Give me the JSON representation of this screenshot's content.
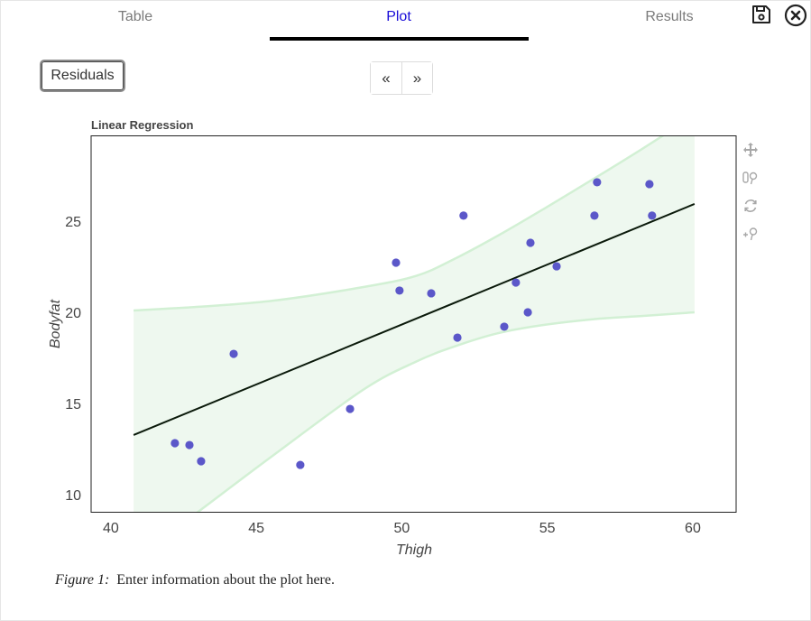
{
  "tabs": [
    {
      "label": "Table",
      "active": false
    },
    {
      "label": "Plot",
      "active": true
    },
    {
      "label": "Results",
      "active": false
    }
  ],
  "header_icons": [
    "save-icon",
    "close-circle-icon"
  ],
  "residuals_button": "Residuals",
  "pager": {
    "prev": "«",
    "next": "»"
  },
  "toolbar": [
    "move-icon",
    "zoom-box-icon",
    "reset-icon",
    "zoom-in-icon"
  ],
  "caption": {
    "figure": "Figure 1:",
    "text": "Enter information about the plot here."
  },
  "colors": {
    "accent_tab": "#1a0dd8",
    "points": "#5b57c9",
    "band_fill": "#eef8ef",
    "band_line": "#d2f0d4",
    "fit_line": "#0b1a0b"
  },
  "chart_data": {
    "type": "scatter",
    "title": "Linear Regression",
    "xlabel": "Thigh",
    "ylabel": "Bodyfat",
    "xlim": [
      39.32,
      61.49
    ],
    "ylim": [
      9.06,
      29.7
    ],
    "xticks": [
      40,
      45,
      50,
      55,
      60
    ],
    "yticks": [
      10,
      15,
      20,
      25
    ],
    "grid": false,
    "points": [
      {
        "x": 42.2,
        "y": 12.82
      },
      {
        "x": 42.7,
        "y": 12.72
      },
      {
        "x": 43.1,
        "y": 11.83
      },
      {
        "x": 44.22,
        "y": 17.72
      },
      {
        "x": 46.51,
        "y": 11.63
      },
      {
        "x": 48.22,
        "y": 14.7
      },
      {
        "x": 49.8,
        "y": 22.72
      },
      {
        "x": 49.92,
        "y": 21.19
      },
      {
        "x": 51.01,
        "y": 21.04
      },
      {
        "x": 52.12,
        "y": 25.3
      },
      {
        "x": 51.91,
        "y": 18.61
      },
      {
        "x": 53.52,
        "y": 19.21
      },
      {
        "x": 53.92,
        "y": 21.63
      },
      {
        "x": 54.33,
        "y": 20.0
      },
      {
        "x": 54.42,
        "y": 23.81
      },
      {
        "x": 55.32,
        "y": 22.52
      },
      {
        "x": 56.71,
        "y": 27.13
      },
      {
        "x": 56.62,
        "y": 25.3
      },
      {
        "x": 58.51,
        "y": 27.03
      },
      {
        "x": 58.6,
        "y": 25.3
      }
    ],
    "fit_line": {
      "x": [
        40.78,
        60.06
      ],
      "y": [
        13.27,
        25.94
      ]
    },
    "band_upper": {
      "x": [
        40.78,
        43.0,
        45.6,
        48.7,
        50.5,
        51.8,
        53.3,
        54.9,
        56.8,
        58.3,
        60.06
      ],
      "y": [
        20.1,
        20.3,
        20.64,
        21.39,
        22.0,
        22.92,
        24.2,
        25.69,
        27.52,
        29.0,
        30.8
      ]
    },
    "band_lower": {
      "x": [
        40.78,
        43.0,
        45.6,
        48.7,
        50.5,
        51.8,
        53.3,
        54.9,
        56.8,
        58.3,
        60.06
      ],
      "y": [
        6.4,
        9.06,
        12.18,
        15.78,
        17.3,
        18.12,
        18.85,
        19.31,
        19.65,
        19.8,
        20.0
      ]
    }
  }
}
